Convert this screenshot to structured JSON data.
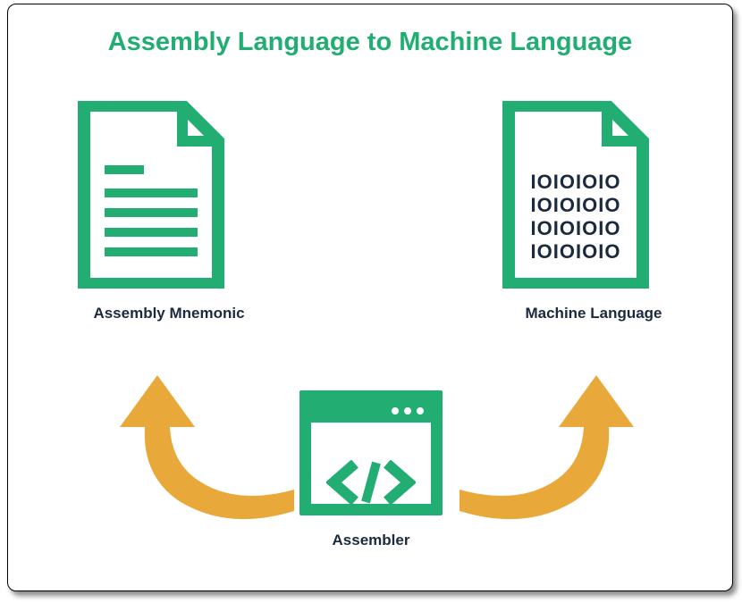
{
  "title": "Assembly Language to Machine Language",
  "nodes": {
    "left": {
      "label": "Assembly Mnemonic"
    },
    "right": {
      "label": "Machine Language",
      "binary_lines": [
        "IOIOIOIO",
        "IOIOIOIO",
        "IOIOIOIO",
        "IOIOIOIO"
      ]
    },
    "bottom": {
      "label": "Assembler"
    }
  },
  "colors": {
    "accent": "#22AE73",
    "arrow": "#E9A93A",
    "text": "#1B2A3F"
  }
}
